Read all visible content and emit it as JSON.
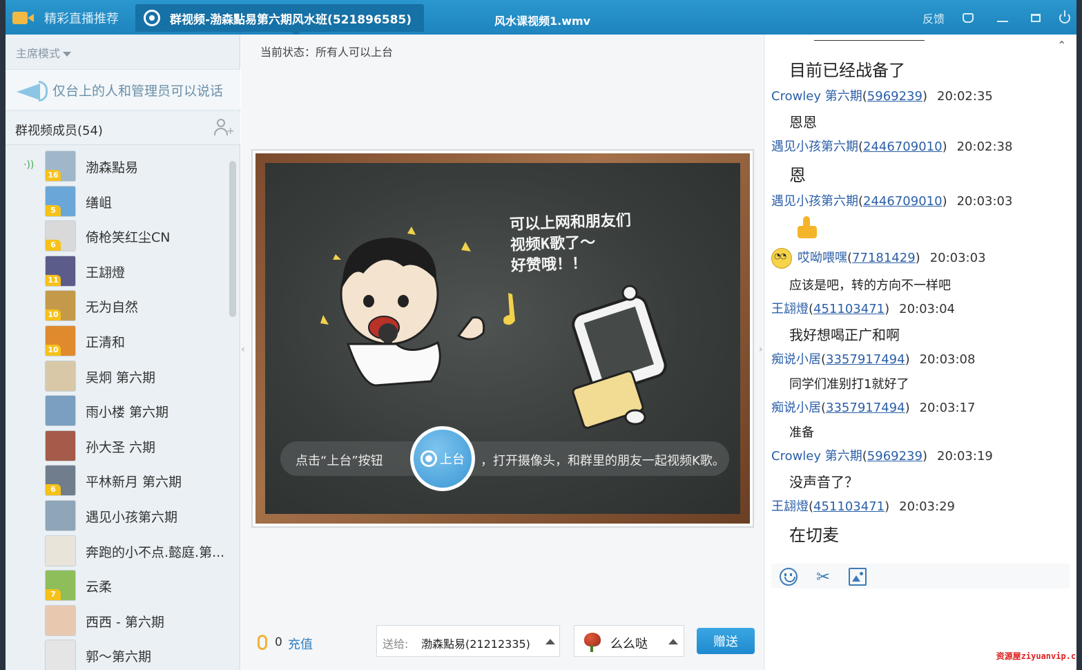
{
  "window": {
    "tabs": [
      {
        "label": "精彩直播推荐"
      },
      {
        "label": "群视频-渤森點易第六期风水班(521896585)"
      }
    ],
    "video_title": "风水课视频1.wmv",
    "controls": {
      "feedback": "反馈"
    }
  },
  "left": {
    "mode_label": "主席模式",
    "notice": "仅台上的人和管理员可以说话",
    "members_title": "群视频成员(54)",
    "members": [
      {
        "name": "渤森點易",
        "level": "16",
        "speaking": true,
        "avatar_color": "#9fb7c9"
      },
      {
        "name": "缮岨",
        "level": "5",
        "speaking": false,
        "avatar_color": "#6aa7d8"
      },
      {
        "name": "倚枪笑红尘CN",
        "level": "6",
        "speaking": false,
        "avatar_color": "#d9d9d9"
      },
      {
        "name": "王翃燈",
        "level": "11",
        "speaking": false,
        "avatar_color": "#5c5c8a"
      },
      {
        "name": "无为自然",
        "level": "10",
        "speaking": false,
        "avatar_color": "#c49a4a"
      },
      {
        "name": "正清和",
        "level": "10",
        "speaking": false,
        "avatar_color": "#e08a2e"
      },
      {
        "name": "吴炯 第六期",
        "level": "",
        "speaking": false,
        "avatar_color": "#d8c8a8"
      },
      {
        "name": "雨小楼 第六期",
        "level": "",
        "speaking": false,
        "avatar_color": "#7a9fc0"
      },
      {
        "name": "孙大圣 六期",
        "level": "",
        "speaking": false,
        "avatar_color": "#a55a4a"
      },
      {
        "name": "平林新月 第六期",
        "level": "6",
        "speaking": false,
        "avatar_color": "#6f7d8c"
      },
      {
        "name": "遇见小孩第六期",
        "level": "",
        "speaking": false,
        "avatar_color": "#8fa5b8"
      },
      {
        "name": "奔跑的小不点.懿庭.第...",
        "level": "",
        "speaking": false,
        "avatar_color": "#e8e4da"
      },
      {
        "name": "云柔",
        "level": "7",
        "speaking": false,
        "avatar_color": "#8ebe5a"
      },
      {
        "name": "西西 - 第六期",
        "level": "",
        "speaking": false,
        "avatar_color": "#e8c9b0"
      },
      {
        "name": "郭～第六期",
        "level": "",
        "speaking": false,
        "avatar_color": "#e5e5e5"
      }
    ]
  },
  "center": {
    "status": "当前状态：所有人可以上台",
    "board_text": [
      "可以上网和朋友们",
      "视频K歌了～",
      "好赞哦！！"
    ],
    "cta_left": "点击“上台”按钮",
    "stage_button": "上台",
    "cta_right": "，打开摄像头，和群里的朋友一起视频K歌。",
    "coins": "0",
    "recharge": "充值",
    "send_to_label": "送给:",
    "send_to_value": "渤森點易(21212335)",
    "gift_name": "么么哒",
    "give_button": "赠送"
  },
  "chat": [
    {
      "type": "body",
      "size": "big",
      "text": "目前已经战备了"
    },
    {
      "type": "head",
      "who": "Crowley 第六期",
      "qq": "5969239",
      "time": "20:02:35"
    },
    {
      "type": "body",
      "size": "mid",
      "text": "恩恩"
    },
    {
      "type": "head",
      "who": "遇见小孩第六期",
      "qq": "2446709010",
      "time": "20:02:38"
    },
    {
      "type": "body",
      "size": "big",
      "text": "恩"
    },
    {
      "type": "head",
      "who": "遇见小孩第六期",
      "qq": "2446709010",
      "time": "20:03:03"
    },
    {
      "type": "thumb"
    },
    {
      "type": "head",
      "who": "哎呦喂嘿",
      "qq": "77181429",
      "time": "20:03:03",
      "smiley": true
    },
    {
      "type": "body",
      "size": "sm",
      "text": "应该是吧，转的方向不一样吧"
    },
    {
      "type": "head",
      "who": "王翃燈",
      "qq": "451103471",
      "time": "20:03:04"
    },
    {
      "type": "body",
      "size": "mid",
      "text": "我好想喝正广和啊"
    },
    {
      "type": "head",
      "who": "痴说小居",
      "qq": "3357917494",
      "time": "20:03:08"
    },
    {
      "type": "body",
      "size": "sm",
      "text": "同学们准别打1就好了"
    },
    {
      "type": "head",
      "who": "痴说小居",
      "qq": "3357917494",
      "time": "20:03:17"
    },
    {
      "type": "body",
      "size": "sm",
      "text": "准备"
    },
    {
      "type": "head",
      "who": "Crowley 第六期",
      "qq": "5969239",
      "time": "20:03:19"
    },
    {
      "type": "body",
      "size": "mid",
      "text": "没声音了？"
    },
    {
      "type": "head",
      "who": "王翃燈",
      "qq": "451103471",
      "time": "20:03:29"
    },
    {
      "type": "body",
      "size": "big",
      "text": "在切麦"
    }
  ],
  "watermark": "资源屋ziyuanvip.cn",
  "colors": {
    "titlebar": "#1e84bd",
    "accent": "#2e7fc1",
    "link": "#2b5fa8",
    "level_badge": "#f6c21a"
  }
}
